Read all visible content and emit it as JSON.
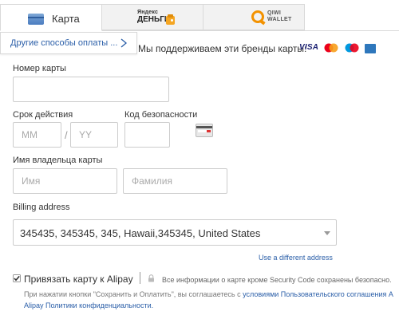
{
  "tabs": [
    {
      "label": "Карта",
      "icon": "credit-card-icon"
    },
    {
      "logo_line1": "Яндекс",
      "logo_line2": "ДЕНЬГИ",
      "icon": "yandex-money-logo"
    },
    {
      "logo_line1": "QIWI",
      "logo_line2": "WALLET",
      "icon": "qiwi-wallet-logo"
    }
  ],
  "other_methods": {
    "label": "Другие способы оплаты ...",
    "icon": "chevron-right-icon"
  },
  "brands": {
    "text": "Мы поддерживаем эти бренды карты:",
    "items": [
      {
        "name": "VISA",
        "icon": "visa-logo"
      },
      {
        "name": "MasterCard",
        "icon": "mastercard-logo"
      },
      {
        "name": "Maestro",
        "icon": "maestro-logo"
      },
      {
        "name": "AmEx",
        "icon": "amex-logo"
      }
    ]
  },
  "form": {
    "card_number": {
      "label": "Номер карты",
      "value": "",
      "placeholder": ""
    },
    "expiry": {
      "label": "Срок действия",
      "month_placeholder": "MM",
      "separator": "/",
      "year_placeholder": "YY"
    },
    "security_code": {
      "label": "Код безопасности",
      "placeholder": "",
      "icon": "cvv-card-icon"
    },
    "holder": {
      "label": "Имя владельца карты",
      "first_placeholder": "Имя",
      "last_placeholder": "Фамилия"
    },
    "billing": {
      "label": "Billing address",
      "value": "345435, 345345, 345, Hawaii,345345, United States",
      "use_different": "Use a different address"
    }
  },
  "alipay": {
    "checked": true,
    "label": "Привязать карту к Alipay",
    "secure_note": "Все информации о карте кроме Security Code сохранены безопасно.",
    "terms_prefix": "При нажатии кнопки \"Сохранить и Оплатить\", вы соглашаетесь с ",
    "terms_link1": "условиями Пользовательского соглашения A",
    "terms_link2": "Alipay Политики конфиденциальности."
  },
  "colors": {
    "link": "#2a5ea8",
    "qiwi_orange": "#f39200",
    "visa_blue": "#1a1f71",
    "amex_blue": "#2e77bc"
  }
}
